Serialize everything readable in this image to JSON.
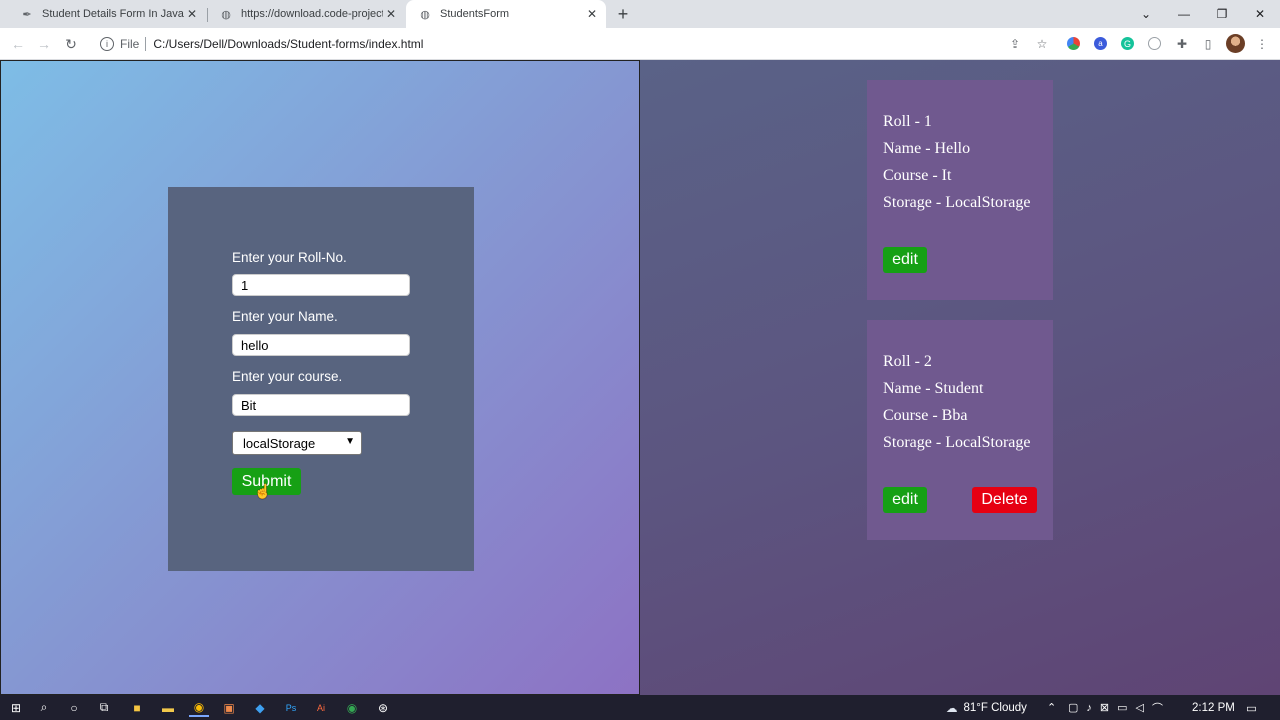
{
  "browser": {
    "tabs": [
      {
        "title": "Student Details Form In JavaScript",
        "icon": "code-projects-icon",
        "active": false
      },
      {
        "title": "https://download.code-projects.org",
        "icon": "globe-icon",
        "active": false
      },
      {
        "title": "StudentsForm",
        "icon": "globe-icon",
        "active": true
      }
    ],
    "address": {
      "protocol": "File",
      "url": "C:/Users/Dell/Downloads/Student-forms/index.html"
    }
  },
  "form": {
    "roll_label": "Enter your Roll-No.",
    "roll_value": "1",
    "name_label": "Enter your Name.",
    "name_value": "hello",
    "course_label": "Enter your course.",
    "course_value": "Bit",
    "storage_selected": "localStorage",
    "submit_label": "Submit"
  },
  "students": [
    {
      "roll": "Roll - 1",
      "name": "Name - Hello",
      "course": "Course - It",
      "storage": "Storage - LocalStorage",
      "edit_label": "edit"
    },
    {
      "roll": "Roll - 2",
      "name": "Name - Student",
      "course": "Course - Bba",
      "storage": "Storage - LocalStorage",
      "edit_label": "edit",
      "delete_label": "Delete"
    }
  ],
  "taskbar": {
    "weather": "81°F  Cloudy",
    "time": "2:12 PM"
  },
  "colors": {
    "submit_green": "#16a014",
    "delete_red": "#e60012",
    "form_card": "#58647f",
    "student_card": "#70598f"
  }
}
